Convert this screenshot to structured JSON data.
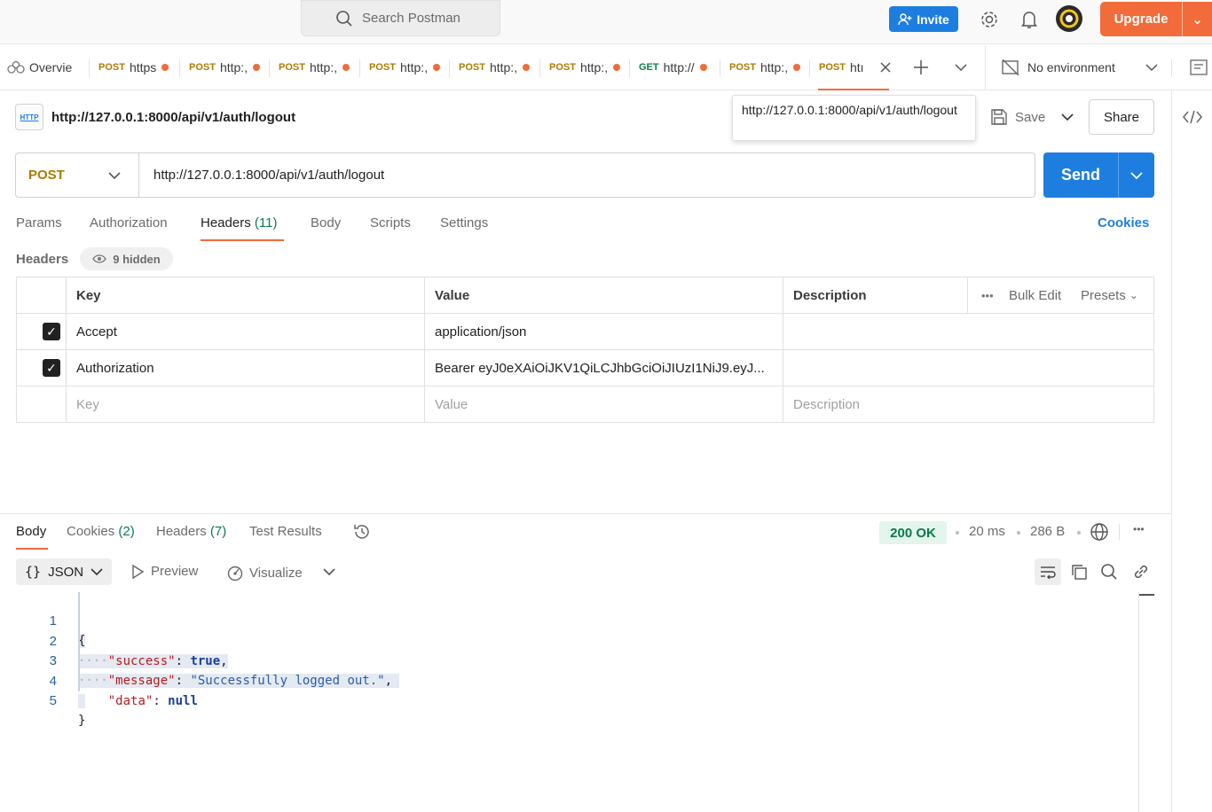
{
  "app": {
    "search_placeholder": "Search Postman",
    "invite_label": "Invite",
    "upgrade_label": "Upgrade"
  },
  "tabs": {
    "overview_label": "Overvie",
    "items": [
      {
        "method": "POST",
        "label": "https"
      },
      {
        "method": "POST",
        "label": "http:,"
      },
      {
        "method": "POST",
        "label": "http:,"
      },
      {
        "method": "POST",
        "label": "http:,"
      },
      {
        "method": "POST",
        "label": "http:,"
      },
      {
        "method": "POST",
        "label": "http:,"
      },
      {
        "method": "GET",
        "label": "http://"
      },
      {
        "method": "POST",
        "label": "http:,"
      },
      {
        "method": "POST",
        "label": "htı"
      }
    ],
    "environment": "No environment"
  },
  "request": {
    "title": "http://127.0.0.1:8000/api/v1/auth/logout",
    "icon_text": "HTTP",
    "tooltip": "http://127.0.0.1:8000/api/v1/auth/logout",
    "save_label": "Save",
    "share_label": "Share",
    "method": "POST",
    "url": "http://127.0.0.1:8000/api/v1/auth/logout",
    "send_label": "Send",
    "tabs": {
      "params": "Params",
      "authorization": "Authorization",
      "headers": "Headers",
      "headers_count": "(11)",
      "body": "Body",
      "scripts": "Scripts",
      "settings": "Settings"
    },
    "cookies_link": "Cookies",
    "headers_label": "Headers",
    "hidden_badge": "9 hidden",
    "table": {
      "col_key": "Key",
      "col_value": "Value",
      "col_description": "Description",
      "bulk_edit": "Bulk Edit",
      "presets": "Presets",
      "rows": [
        {
          "key": "Accept",
          "value": "application/json",
          "description": ""
        },
        {
          "key": "Authorization",
          "value": "Bearer eyJ0eXAiOiJKV1QiLCJhbGciOiJIUzI1NiJ9.eyJ...",
          "description": ""
        }
      ],
      "placeholder_key": "Key",
      "placeholder_value": "Value",
      "placeholder_description": "Description"
    }
  },
  "response": {
    "tabs": {
      "body": "Body",
      "cookies": "Cookies",
      "cookies_count": "(2)",
      "headers": "Headers",
      "headers_count": "(7)",
      "test_results": "Test Results"
    },
    "status": "200 OK",
    "time": "20 ms",
    "size": "286 B",
    "format": "JSON",
    "preview_label": "Preview",
    "visualize_label": "Visualize",
    "code_lines": [
      {
        "num": "1"
      },
      {
        "num": "2",
        "key": "\"success\"",
        "val": "true"
      },
      {
        "num": "3",
        "key": "\"message\"",
        "val": "\"Successfully logged out.\""
      },
      {
        "num": "4",
        "key": "\"data\"",
        "val": "null"
      },
      {
        "num": "5"
      }
    ]
  }
}
